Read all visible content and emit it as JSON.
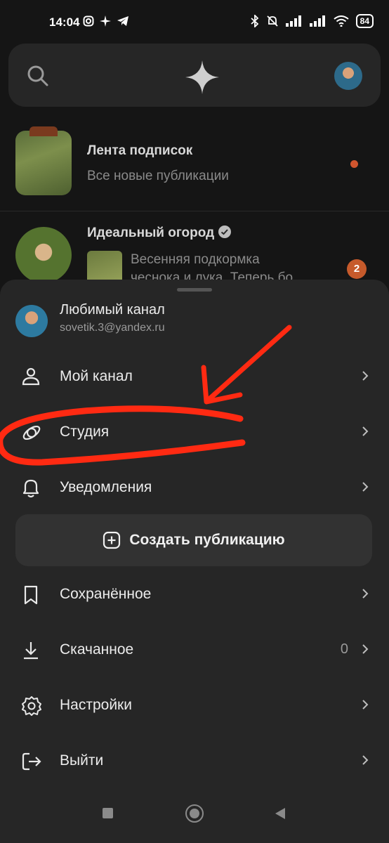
{
  "status": {
    "time": "14:04",
    "battery": "84"
  },
  "feed": {
    "subscriptions": {
      "title": "Лента подписок",
      "subtitle": "Все новые публикации"
    },
    "channel": {
      "title": "Идеальный огород",
      "post_line1": "Весенняя подкормка",
      "post_line2": "чеснока и лука. Теперь бо",
      "badge": "2"
    }
  },
  "profile": {
    "name": "Любимый канал",
    "email": "sovetik.3@yandex.ru"
  },
  "menu": {
    "my_channel": "Мой канал",
    "studio": "Студия",
    "notifications": "Уведомления",
    "create_post": "Создать публикацию",
    "saved": "Сохранённое",
    "downloaded": "Скачанное",
    "downloaded_count": "0",
    "settings": "Настройки",
    "logout": "Выйти"
  },
  "colors": {
    "background": "#151515",
    "sheet": "#262626",
    "accent": "#d0552e",
    "annotation": "#ff2a12"
  }
}
